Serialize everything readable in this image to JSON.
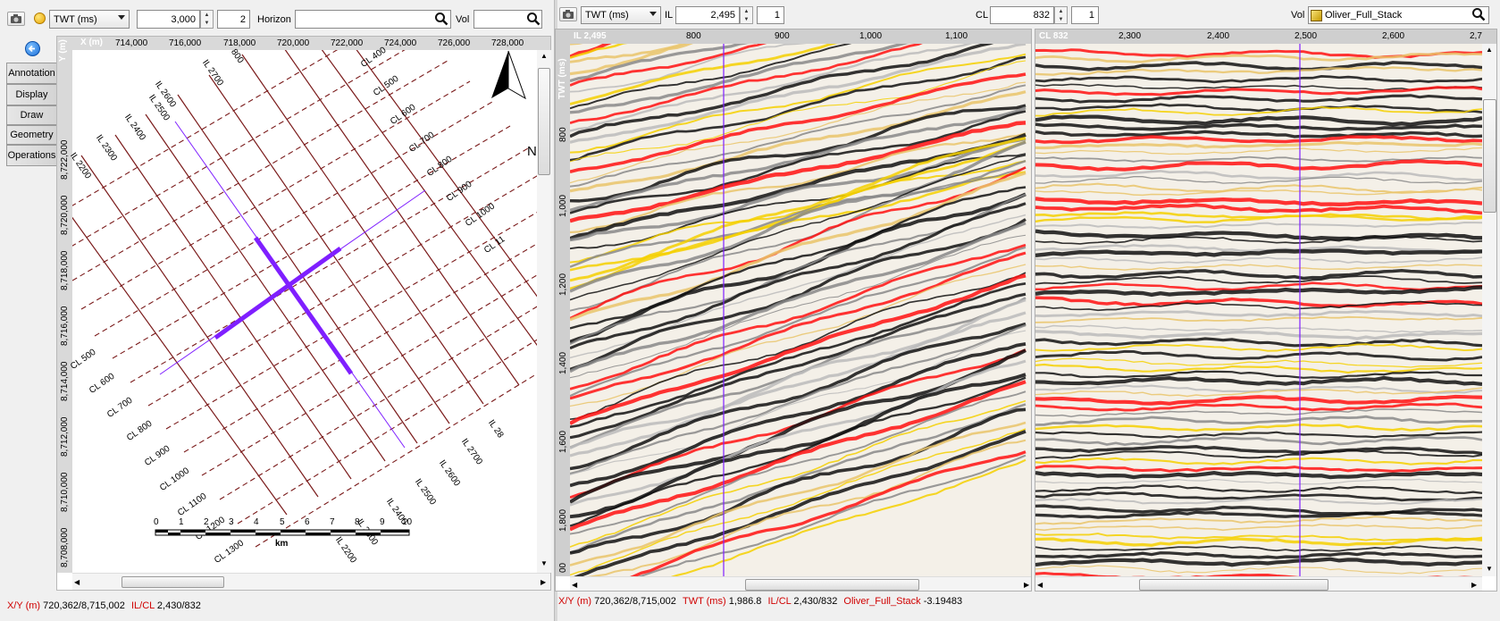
{
  "map_toolbar": {
    "domain_value": "TWT (ms)",
    "time_value": "3,000",
    "step_value": "2",
    "horizon_label": "Horizon",
    "horizon_value": "",
    "vol_label": "Vol",
    "vol_value": ""
  },
  "section_toolbar": {
    "domain_value": "TWT (ms)",
    "il_label": "IL",
    "il_value": "2,495",
    "il_step": "1",
    "cl_label": "CL",
    "cl_value": "832",
    "cl_step": "1",
    "vol_label": "Vol",
    "vol_value": "Oliver_Full_Stack"
  },
  "side_tabs": [
    "Annotation",
    "Display",
    "Draw",
    "Geometry",
    "Operations"
  ],
  "map": {
    "x_axis_label": "X (m)",
    "x_ticks": [
      "714,000",
      "716,000",
      "718,000",
      "720,000",
      "722,000",
      "724,000",
      "726,000",
      "728,000"
    ],
    "y_axis_label": "Y (m)",
    "y_ticks": [
      "8,722,000",
      "8,720,000",
      "8,718,000",
      "8,716,000",
      "8,714,000",
      "8,712,000",
      "8,710,000",
      "8,708,000",
      "8,706,000"
    ],
    "north_label": "N",
    "il_labels": [
      "IL 2200",
      "IL 2300",
      "IL 2400",
      "IL 2500",
      "IL 2600",
      "IL 2700",
      "800"
    ],
    "cl_top_labels": [
      "CL 400",
      "CL 500",
      "CL 600",
      "CL 700",
      "CL 800",
      "CL 900",
      "CL 1000",
      "CL 11"
    ],
    "cl_left_labels": [
      "CL 500",
      "CL 600",
      "CL 700",
      "CL 800",
      "CL 900",
      "CL 1000",
      "CL 1100",
      "CL 1200",
      "CL 1300"
    ],
    "il_bottom_labels": [
      "IL 2200",
      "IL 2300",
      "IL 2400",
      "IL 2500",
      "IL 2600",
      "IL 2700",
      "IL 28"
    ],
    "scale_ticks": [
      "0",
      "1",
      "2",
      "3",
      "4",
      "5",
      "6",
      "7",
      "8",
      "9",
      "10"
    ],
    "scale_unit": "km"
  },
  "il_section": {
    "title": "IL 2,495",
    "ticks": [
      "800",
      "900",
      "1,000",
      "1,100"
    ]
  },
  "cl_section": {
    "title": "CL 832",
    "ticks": [
      "2,300",
      "2,400",
      "2,500",
      "2,600",
      "2,7"
    ]
  },
  "twt_axis": {
    "label": "TWT (ms)",
    "ticks": [
      "800",
      "1,000",
      "1,200",
      "1,400",
      "1,600",
      "1,800",
      "00"
    ]
  },
  "status_left": {
    "xy_label": "X/Y (m)",
    "xy_value": "720,362/8,715,002",
    "ilcl_label": "IL/CL",
    "ilcl_value": "2,430/832"
  },
  "status_right": {
    "xy_label": "X/Y (m)",
    "xy_value": "720,362/8,715,002",
    "twt_label": "TWT (ms)",
    "twt_value": "1,986.8",
    "ilcl_label": "IL/CL",
    "ilcl_value": "2,430/832",
    "vol_label": "Oliver_Full_Stack",
    "vol_value": "-3.19483"
  },
  "colors": {
    "grid_line": "#7a1a1a",
    "selection": "#7f1fff",
    "seis_red": "#ff1010",
    "seis_yellow": "#f5d000"
  }
}
